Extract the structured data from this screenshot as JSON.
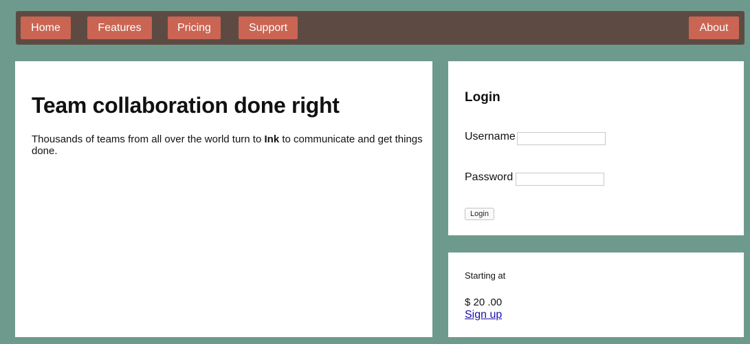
{
  "nav": {
    "items": [
      "Home",
      "Features",
      "Pricing",
      "Support"
    ],
    "about": "About"
  },
  "hero": {
    "title": "Team collaboration done right",
    "text_before": "Thousands of teams from all over the world turn to ",
    "brand": "Ink",
    "text_after": " to communicate and get things done."
  },
  "login": {
    "title": "Login",
    "username_label": "Username",
    "username_value": "",
    "password_label": "Password",
    "password_value": "",
    "button_label": "Login"
  },
  "pricing": {
    "starting_label": "Starting at",
    "amount": "$ 20 .00",
    "signup_label": "Sign up"
  },
  "colors": {
    "background": "#6e9a8d",
    "nav_bar": "#5d4b43",
    "nav_button": "#c96552",
    "link": "#1a0dab"
  }
}
